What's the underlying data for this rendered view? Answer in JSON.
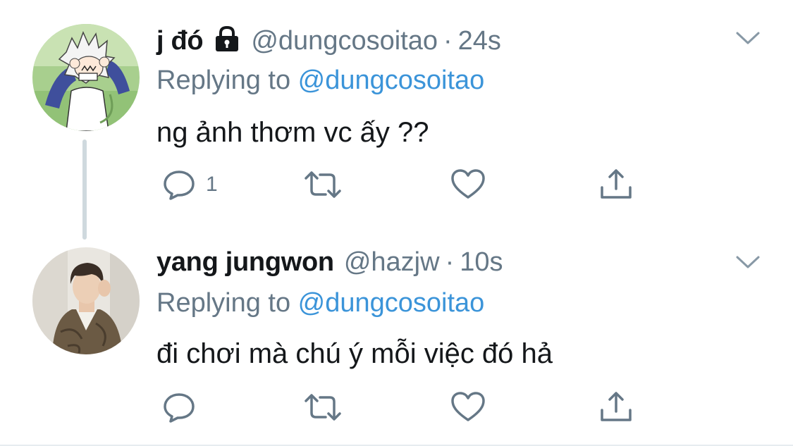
{
  "tweets": [
    {
      "display_name": "j đó",
      "protected": true,
      "handle": "@dungcosoitao",
      "separator": "·",
      "time": "24s",
      "replying_prefix": "Replying to ",
      "replying_to": "@dungcosoitao",
      "text": "ng ảnh thơm vc ấy ??",
      "reply_count": "1",
      "avatar_icon": "anime-boy-avatar"
    },
    {
      "display_name": "yang jungwon",
      "protected": false,
      "handle": "@hazjw",
      "separator": "·",
      "time": "10s",
      "replying_prefix": "Replying to ",
      "replying_to": "@dungcosoitao",
      "text": "đi chơi mà chú ý mỗi việc đó hả",
      "reply_count": "",
      "avatar_icon": "person-photo-avatar"
    }
  ],
  "colors": {
    "text": "#14171a",
    "secondary": "#657786",
    "link": "#3b94d9",
    "icon": "#657786",
    "thread_line": "#cfd9de"
  }
}
